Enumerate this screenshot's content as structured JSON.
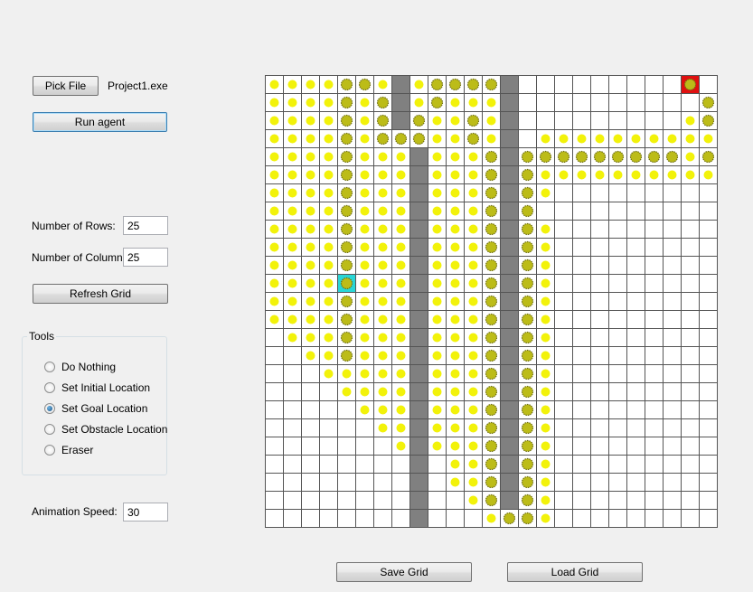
{
  "controls": {
    "pick_file_label": "Pick File",
    "file_name": "Project1.exe",
    "run_agent_label": "Run agent",
    "rows_label": "Number of Rows:",
    "rows_value": "25",
    "cols_label": "Number of Columns:",
    "cols_value": "25",
    "refresh_label": "Refresh Grid",
    "anim_label": "Animation Speed:",
    "anim_value": "30"
  },
  "tools": {
    "title": "Tools",
    "options": [
      {
        "label": "Do Nothing",
        "checked": false
      },
      {
        "label": "Set Initial Location",
        "checked": false
      },
      {
        "label": "Set Goal Location",
        "checked": true
      },
      {
        "label": "Set Obstacle Location",
        "checked": false
      },
      {
        "label": "Eraser",
        "checked": false
      }
    ]
  },
  "bottom": {
    "save_label": "Save Grid",
    "load_label": "Load Grid"
  },
  "grid": {
    "rows": 25,
    "cols": 25,
    "legend": {
      ".": "empty",
      "o": "visited",
      "*": "expanded",
      "#": "obstacle",
      "S": "initial",
      "G": "goal"
    },
    "colors": {
      "line": "#555555",
      "empty": "#ffffff",
      "obstacle": "#808080",
      "visited": "#f2f20a",
      "expanded_fill": "#bcbc18",
      "expanded_edge": "#6f6f14",
      "initial_bg": "#29d6d6",
      "goal_bg": "#e01010"
    },
    "cells": [
      "oooo**o#o****#.........G",
      "oooo*o*#o*ooo#..........*",
      "oooo*o*#*oo*o#.........o*",
      "oooo*o***oo*o#.oooooooooo*",
      "oooo*ooo#ooo*#*********o*",
      "oooo*ooo#ooo*#*oooooooooo",
      "oooo*ooo#ooo*#*o.........",
      "oooo*ooo#ooo*#*..........",
      "oooo*ooo#ooo*#*o.........",
      "oooo*ooo#ooo*#*o.........",
      "oooo*ooo#ooo*#*o.........",
      "ooooSooo#ooo*#*o.........",
      "oooo*ooo#ooo*#*o.........",
      "oooo*ooo#ooo*#*o.........",
      ".ooo*ooo#ooo*#*o.........",
      "..oo*ooo#ooo*#*o.........",
      "...ooooo#ooo*#*o.........",
      "....oooo#ooo*#*o.........",
      ".....ooo#ooo*#*o.........",
      "......oo#ooo*#*o.........",
      ".......o#ooo*#*o.........",
      "........#.oo*#*o.........",
      "........#.oo*#*o.........",
      "........#..o*#*o.........",
      "........#...o**o........."
    ]
  }
}
